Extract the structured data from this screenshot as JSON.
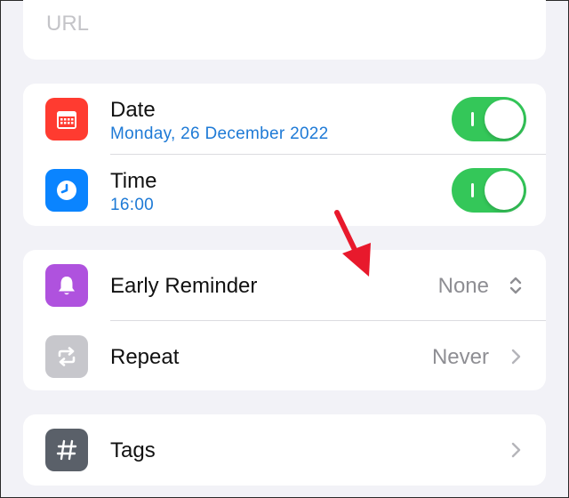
{
  "url_field": {
    "placeholder": "URL"
  },
  "date_row": {
    "label": "Date",
    "value": "Monday, 26 December 2022",
    "toggle_on": true
  },
  "time_row": {
    "label": "Time",
    "value": "16:00",
    "toggle_on": true
  },
  "early_reminder_row": {
    "label": "Early Reminder",
    "value": "None"
  },
  "repeat_row": {
    "label": "Repeat",
    "value": "Never"
  },
  "tags_row": {
    "label": "Tags"
  },
  "icons": {
    "date": "calendar-icon",
    "time": "clock-icon",
    "early_reminder": "bell-icon",
    "repeat": "repeat-icon",
    "tags": "hashtag-icon",
    "annotation": "red-arrow"
  },
  "colors": {
    "background": "#f2f2f7",
    "card": "#ffffff",
    "date_icon_bg": "#ff3b30",
    "time_icon_bg": "#0a84ff",
    "reminder_icon_bg": "#af52de",
    "repeat_icon_bg": "#c7c7cc",
    "tags_icon_bg": "#5a6069",
    "toggle_on": "#34c759",
    "accent_text": "#1e7ad6",
    "annotation_arrow": "#e8192c"
  }
}
